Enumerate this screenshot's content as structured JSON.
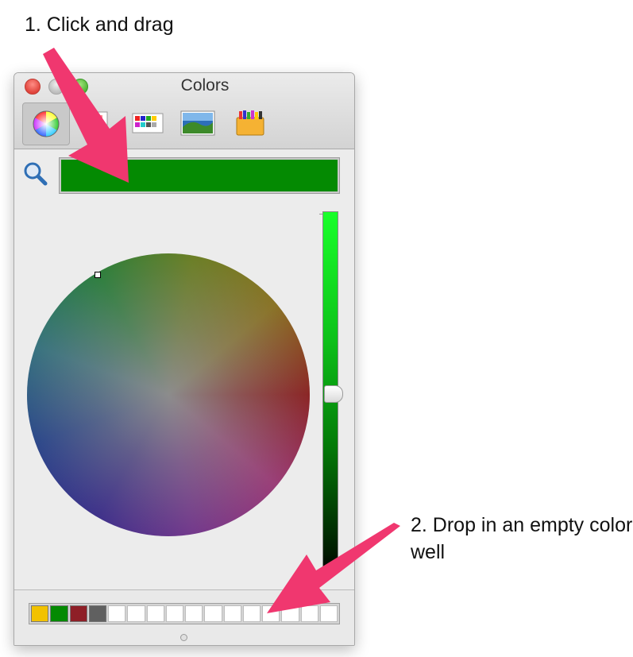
{
  "annotations": {
    "step1": "1. Click and drag",
    "step2": "2. Drop in an empty color well"
  },
  "window": {
    "title": "Colors",
    "traffic_lights": [
      "close",
      "minimize",
      "zoom"
    ],
    "toolbar_tabs": [
      {
        "name": "color-wheel",
        "icon": "color-wheel-icon",
        "selected": true
      },
      {
        "name": "color-sliders",
        "icon": "sliders-icon",
        "selected": false
      },
      {
        "name": "color-palettes",
        "icon": "palettes-icon",
        "selected": false
      },
      {
        "name": "image-palettes",
        "icon": "image-icon",
        "selected": false
      },
      {
        "name": "pencils",
        "icon": "crayons-icon",
        "selected": false
      }
    ],
    "current_color": "#048a02",
    "brightness_slider": {
      "min_color": "#000000",
      "max_color": "#19ff2a",
      "value_fraction": 0.5
    },
    "color_wells": [
      "#f2c200",
      "#048a02",
      "#8e1f27",
      "#606060",
      "empty",
      "empty",
      "empty",
      "empty",
      "empty",
      "empty",
      "empty",
      "empty",
      "empty",
      "empty",
      "empty",
      "empty"
    ]
  },
  "colors": {
    "arrow": "#f0376f",
    "window_bg": "#ececec"
  }
}
